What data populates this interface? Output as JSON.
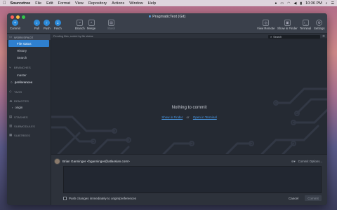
{
  "menubar": {
    "app": "Sourcetree",
    "items": [
      "File",
      "Edit",
      "Format",
      "View",
      "Repository",
      "Actions",
      "Window",
      "Help"
    ],
    "clock": "10:36 PM"
  },
  "window": {
    "title": "PragmaticText (Git)"
  },
  "toolbar": {
    "left": [
      {
        "label": "Commit",
        "icon": "commit-icon"
      },
      {
        "label": "Pull",
        "icon": "pull-icon"
      },
      {
        "label": "Push",
        "icon": "push-icon"
      },
      {
        "label": "Fetch",
        "icon": "fetch-icon"
      },
      {
        "label": "Branch",
        "icon": "branch-icon"
      },
      {
        "label": "Merge",
        "icon": "merge-icon"
      },
      {
        "label": "Stash",
        "icon": "stash-icon"
      }
    ],
    "right": [
      {
        "label": "View Remote",
        "icon": "globe-icon"
      },
      {
        "label": "Show in Finder",
        "icon": "finder-icon"
      },
      {
        "label": "Terminal",
        "icon": "terminal-icon"
      },
      {
        "label": "Settings",
        "icon": "gear-icon"
      }
    ]
  },
  "sidebar": {
    "workspace": "WORKSPACE",
    "workspace_items": [
      "File status",
      "History",
      "Search"
    ],
    "branches": "BRANCHES",
    "branch_items": [
      "master",
      "preferences"
    ],
    "tags": "TAGS",
    "remotes": "REMOTES",
    "remote_items": [
      "origin"
    ],
    "stashes": "STASHES",
    "submodules": "SUBMODULES",
    "subtrees": "SUBTREES"
  },
  "main": {
    "filter_text": "Pending files, sorted by file status",
    "search_placeholder": "Search",
    "empty_title": "Nothing to commit",
    "link_finder": "Show in Finder",
    "link_or": "or",
    "link_terminal": "Open in Terminal"
  },
  "commit": {
    "author": "Brian Ganninger <bganninger@atlassian.com>",
    "options": "Commit Options...",
    "push_label": "Push changes immediately to origin/preferences",
    "cancel": "Cancel",
    "commit": "Commit"
  },
  "colors": {
    "accent": "#2f80cf",
    "window_bg": "#2b313b",
    "main_bg": "#252a33"
  }
}
